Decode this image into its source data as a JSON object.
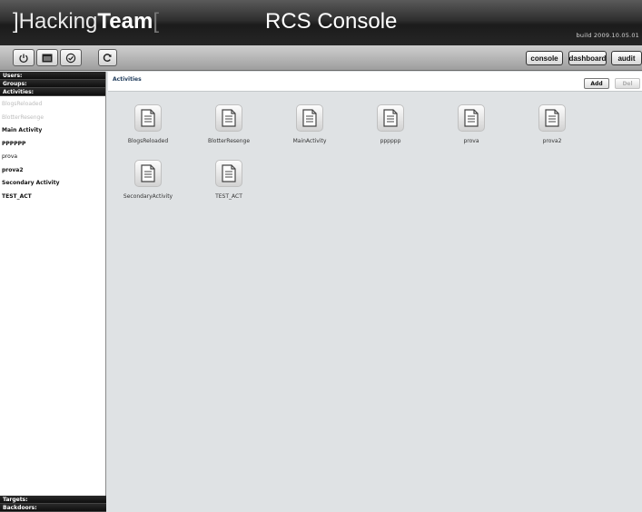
{
  "header": {
    "logo_left_bracket": "]",
    "logo_hacking": "Hacking",
    "logo_team": "Team",
    "logo_right_bracket": "[",
    "title": "RCS Console",
    "build": "build 2009.10.05.01"
  },
  "toolbar": {
    "icon_buttons": [
      "power-icon",
      "window-icon",
      "check-icon",
      "refresh-icon"
    ],
    "nav": {
      "console": "console",
      "dashboard": "dashboard",
      "audit": "audit"
    }
  },
  "sidebar": {
    "users": "Users:",
    "groups": "Groups:",
    "activities": "Activities:",
    "items": [
      {
        "label": "BlogsReloaded",
        "dim": true
      },
      {
        "label": "BlotterResenge",
        "dim": true
      },
      {
        "label": "Main Activity",
        "dim": false
      },
      {
        "label": "PPPPPP",
        "dim": false
      },
      {
        "label": "prova",
        "dim": false
      },
      {
        "label": "prova2",
        "dim": false
      },
      {
        "label": "Secondary Activity",
        "dim": false
      },
      {
        "label": "TEST_ACT",
        "dim": false
      }
    ],
    "targets": "Targets:",
    "backdoors": "Backdoors:"
  },
  "main": {
    "title": "Activities",
    "add": "Add",
    "del": "Del",
    "tiles": [
      "BlogsReloaded",
      "BlotterResenge",
      "MainActivity",
      "pppppp",
      "prova",
      "prova2",
      "SecondaryActivity",
      "TEST_ACT"
    ]
  },
  "colors": {
    "header_dark": "#1b1b1b",
    "panel_bg": "#dfe2e4",
    "title_blue": "#1e3a5a"
  }
}
